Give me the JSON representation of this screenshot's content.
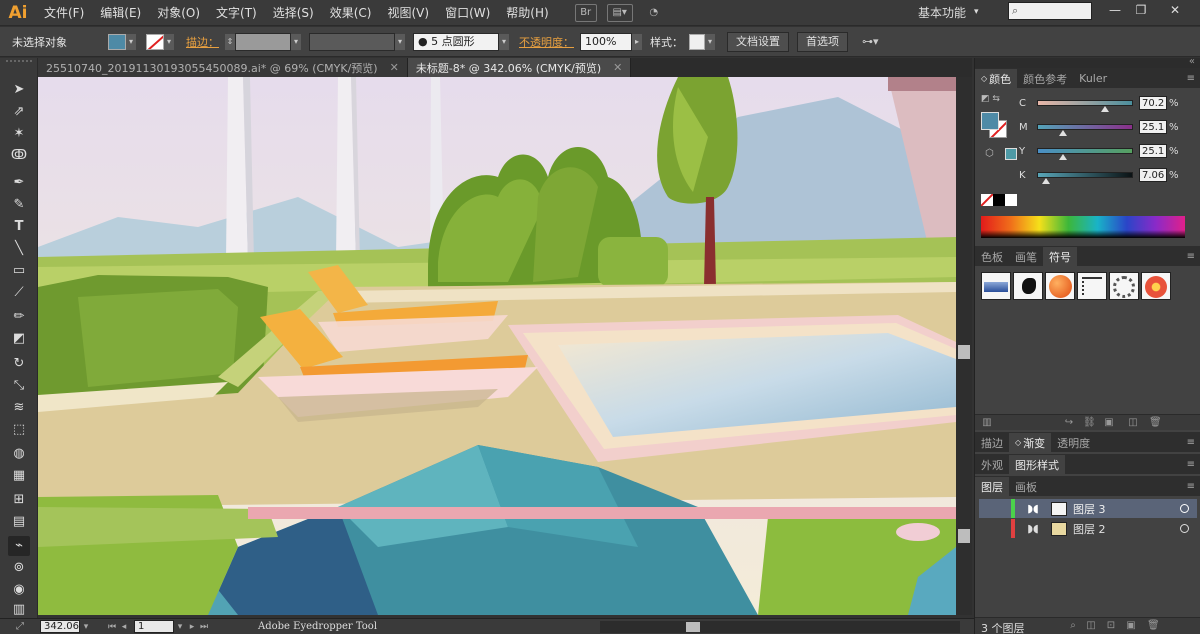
{
  "app": {
    "logo": "Ai"
  },
  "menu": [
    "文件(F)",
    "编辑(E)",
    "对象(O)",
    "文字(T)",
    "选择(S)",
    "效果(C)",
    "视图(V)",
    "窗口(W)",
    "帮助(H)"
  ],
  "menubar_icons": {
    "br": "Br"
  },
  "workspace": "基本功能",
  "search": {
    "placeholder": ""
  },
  "window_buttons": {
    "minimize": "—",
    "restore": "❐",
    "close": "✕"
  },
  "control": {
    "selection": "未选择对象",
    "stroke_label": "描边：",
    "point_size": "5 点圆形",
    "opacity_label": "不透明度：",
    "opacity_value": "100%",
    "style_label": "样式：",
    "doc_setup": "文档设置",
    "preferences": "首选项",
    "fill_color": "#4e8aa6"
  },
  "tabs": [
    {
      "label": "25510740_20191130193055450089.ai* @ 69% (CMYK/预览)",
      "close": "✕",
      "active": false
    },
    {
      "label": "未标题-8* @ 342.06% (CMYK/预览)",
      "close": "✕",
      "active": true
    }
  ],
  "tools": [
    "selection-tool-icon",
    "direct-selection-tool-icon",
    "magic-wand-tool-icon",
    "lasso-tool-icon",
    "pen-tool-icon",
    "curvature-tool-icon",
    "type-tool-icon",
    "line-tool-icon",
    "rectangle-tool-icon",
    "paintbrush-tool-icon",
    "pencil-tool-icon",
    "eraser-tool-icon",
    "rotate-tool-icon",
    "scale-tool-icon",
    "warp-tool-icon",
    "free-transform-tool-icon",
    "shape-builder-tool-icon",
    "perspective-tool-icon",
    "mesh-tool-icon",
    "gradient-tool-icon",
    "eyedropper-tool-icon",
    "blend-tool-icon",
    "symbol-sprayer-tool-icon",
    "column-graph-tool-icon"
  ],
  "status": {
    "zoom": "342.06",
    "artboard": "1",
    "tool_name": "Adobe Eyedropper Tool"
  },
  "color_panel": {
    "tabs": [
      "颜色",
      "颜色参考",
      "Kuler"
    ],
    "channels": [
      {
        "label": "C",
        "value": "70.2",
        "pct": "%",
        "fraction": 0.702,
        "gradient": "linear-gradient(to right,#e8b6a8,#4b8f9d)"
      },
      {
        "label": "M",
        "value": "25.1",
        "pct": "%",
        "fraction": 0.251,
        "gradient": "linear-gradient(to right,#53a3b8,#8a2f8a)"
      },
      {
        "label": "Y",
        "value": "25.1",
        "pct": "%",
        "fraction": 0.251,
        "gradient": "linear-gradient(to right,#4a8fc6,#56a060)"
      },
      {
        "label": "K",
        "value": "7.06",
        "pct": "%",
        "fraction": 0.0706,
        "gradient": "linear-gradient(to right,#59a6b8,#0b1214)"
      }
    ],
    "fill": "#4e8aa6"
  },
  "swatch_panel": {
    "tabs": [
      "色板",
      "画笔",
      "符号"
    ]
  },
  "appearance_panel": {
    "tabs": [
      "描边",
      "渐变",
      "透明度"
    ]
  },
  "style_panel": {
    "tabs": [
      "外观",
      "图形样式"
    ]
  },
  "layers_panel": {
    "tabs": [
      "图层",
      "画板"
    ],
    "layers": [
      {
        "name": "图层 3",
        "selected": true
      },
      {
        "name": "图层 2",
        "selected": false
      }
    ],
    "count": "3 个图层"
  }
}
